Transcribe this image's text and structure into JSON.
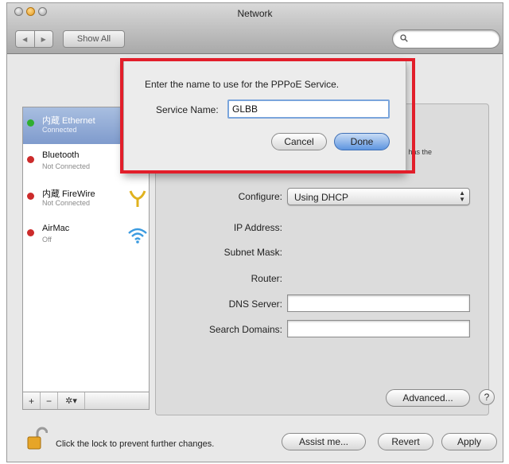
{
  "window": {
    "title": "Network"
  },
  "toolbar": {
    "show_all_label": "Show All"
  },
  "sidebar": {
    "items": [
      {
        "name": "内蔵 Ethernet",
        "status": "Connected",
        "status_color": "#2fae2f",
        "icon": "ethernet-icon",
        "selected": true
      },
      {
        "name": "Bluetooth",
        "status": "Not Connected",
        "status_color": "#cc2b2b",
        "icon": "bluetooth-icon",
        "selected": false
      },
      {
        "name": "内蔵 FireWire",
        "status": "Not Connected",
        "status_color": "#cc2b2b",
        "icon": "firewire-icon",
        "selected": false
      },
      {
        "name": "AirMac",
        "status": "Off",
        "status_color": "#cc2b2b",
        "icon": "wifi-icon",
        "selected": false
      }
    ],
    "controls": {
      "add": "+",
      "remove": "−",
      "gear": "✲▾"
    }
  },
  "panel": {
    "partial_status_text": "and has the",
    "configure_label": "Configure:",
    "configure_value": "Using DHCP",
    "ip_label": "IP Address:",
    "subnet_label": "Subnet Mask:",
    "router_label": "Router:",
    "dns_label": "DNS Server:",
    "search_domains_label": "Search Domains:",
    "advanced_button": "Advanced...",
    "help_button": "?"
  },
  "footer": {
    "lock_text": "Click the lock to prevent further changes.",
    "assist_button": "Assist me...",
    "revert_button": "Revert",
    "apply_button": "Apply"
  },
  "sheet": {
    "message": "Enter the name to use for the PPPoE Service.",
    "service_name_label": "Service Name:",
    "service_name_value": "GLBB",
    "cancel_button": "Cancel",
    "done_button": "Done"
  },
  "colors": {
    "highlight": "#e21e2a",
    "selection": "#8aa6d6",
    "accent": "#5e95e0"
  }
}
